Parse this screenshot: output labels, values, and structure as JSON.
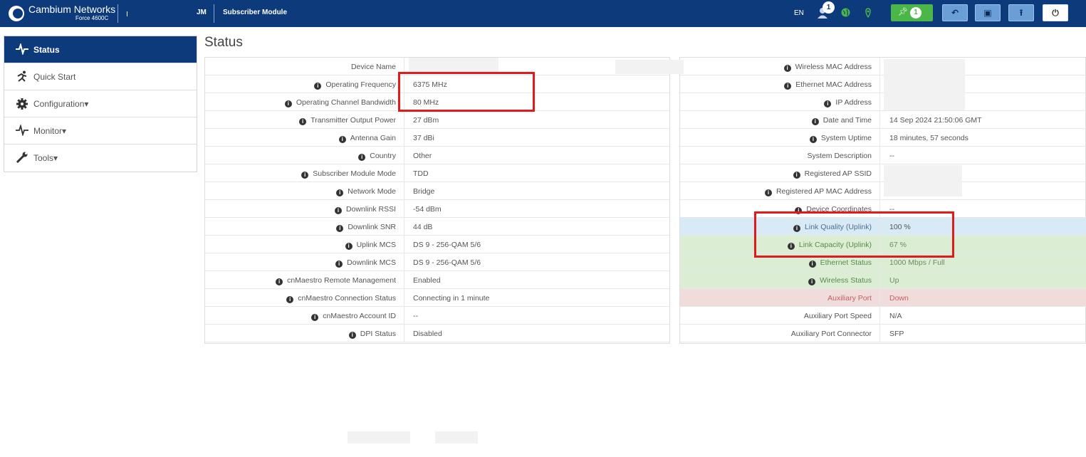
{
  "header": {
    "brand": "Cambium Networks",
    "model": "Force 4600C",
    "mode_abbr": "JM",
    "mode_name": "Subscriber Module",
    "language": "EN",
    "alert_count": "1",
    "notify_count": "1",
    "icons": [
      "alert-user-icon",
      "globe-icon",
      "location-icon",
      "pin-icon",
      "undo-icon",
      "save-icon",
      "reboot-icon",
      "power-icon"
    ]
  },
  "sidebar": {
    "items": [
      {
        "label": "Status",
        "icon": "status-pulse-icon",
        "active": true
      },
      {
        "label": "Quick Start",
        "icon": "runner-icon"
      },
      {
        "label": "Configuration",
        "icon": "gear-icon"
      },
      {
        "label": "Monitor",
        "icon": "pulse-icon"
      },
      {
        "label": "Tools",
        "icon": "wrench-icon"
      }
    ],
    "caret": "▾"
  },
  "page": {
    "title": "Status"
  },
  "left_table": [
    {
      "label": "Device Name",
      "value": "",
      "info": false
    },
    {
      "label": "Operating Frequency",
      "value": "6375 MHz",
      "info": true
    },
    {
      "label": "Operating Channel Bandwidth",
      "value": "80 MHz",
      "info": true
    },
    {
      "label": "Transmitter Output Power",
      "value": "27 dBm",
      "info": true
    },
    {
      "label": "Antenna Gain",
      "value": "37 dBi",
      "info": true
    },
    {
      "label": "Country",
      "value": "Other",
      "info": true
    },
    {
      "label": "Subscriber Module Mode",
      "value": "TDD",
      "info": true
    },
    {
      "label": "Network Mode",
      "value": "Bridge",
      "info": true
    },
    {
      "label": "Downlink RSSI",
      "value": "-54 dBm",
      "info": true
    },
    {
      "label": "Downlink SNR",
      "value": "44 dB",
      "info": true
    },
    {
      "label": "Uplink MCS",
      "value": "DS 9 - 256-QAM 5/6",
      "info": true
    },
    {
      "label": "Downlink MCS",
      "value": "DS 9 - 256-QAM 5/6",
      "info": true
    },
    {
      "label": "cnMaestro Remote Management",
      "value": "Enabled",
      "info": true
    },
    {
      "label": "cnMaestro Connection Status",
      "value": "Connecting in 1 minute",
      "info": true
    },
    {
      "label": "cnMaestro Account ID",
      "value": "--",
      "info": true
    },
    {
      "label": "DPI Status",
      "value": "Disabled",
      "info": true
    }
  ],
  "right_table": [
    {
      "label": "Wireless MAC Address",
      "value": "",
      "info": true
    },
    {
      "label": "Ethernet MAC Address",
      "value": "",
      "info": true
    },
    {
      "label": "IP Address",
      "value": "",
      "info": true
    },
    {
      "label": "Date and Time",
      "value": "14 Sep 2024 21:50:06 GMT",
      "info": true
    },
    {
      "label": "System Uptime",
      "value": "18 minutes, 57 seconds",
      "info": true
    },
    {
      "label": "System Description",
      "value": "--",
      "info": false
    },
    {
      "label": "Registered AP SSID",
      "value": "",
      "info": true
    },
    {
      "label": "Registered AP MAC Address",
      "value": "",
      "info": true
    },
    {
      "label": "Device Coordinates",
      "value": "--",
      "info": true
    },
    {
      "label": "Link Quality (Uplink)",
      "value": "100 %",
      "info": true,
      "status": "blue"
    },
    {
      "label": "Link Capacity (Uplink)",
      "value": "67 %",
      "info": true,
      "status": "green"
    },
    {
      "label": "Ethernet Status",
      "value": "1000 Mbps / Full",
      "info": true,
      "status": "green"
    },
    {
      "label": "Wireless Status",
      "value": "Up",
      "info": true,
      "status": "green"
    },
    {
      "label": "Auxiliary Port",
      "value": "Down",
      "info": false,
      "status": "red"
    },
    {
      "label": "Auxiliary Port Speed",
      "value": "N/A",
      "info": false
    },
    {
      "label": "Auxiliary Port Connector",
      "value": "SFP",
      "info": false
    }
  ],
  "colors": {
    "header_bg": "#0d3a7a",
    "active_nav": "#0d3a7a",
    "highlight_box": "#e11b1b",
    "status_blue": "#d9eaf7",
    "status_green": "#dbeed3",
    "status_red": "#f1dcdc"
  }
}
